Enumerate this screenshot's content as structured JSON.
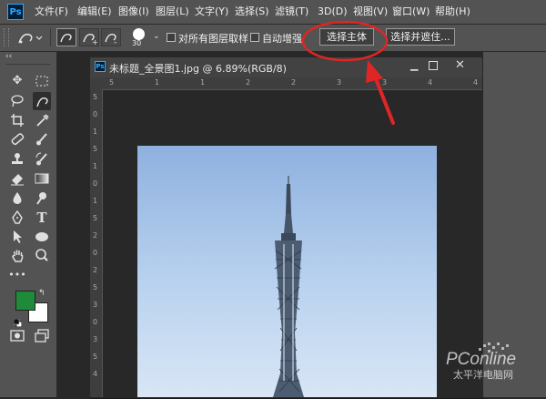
{
  "app": {
    "logo": "Ps"
  },
  "menubar": {
    "items": [
      {
        "id": "file",
        "label": "文件(F)"
      },
      {
        "id": "edit",
        "label": "编辑(E)"
      },
      {
        "id": "image",
        "label": "图像(I)"
      },
      {
        "id": "layer",
        "label": "图层(L)"
      },
      {
        "id": "type",
        "label": "文字(Y)"
      },
      {
        "id": "select",
        "label": "选择(S)"
      },
      {
        "id": "filter",
        "label": "滤镜(T)"
      },
      {
        "id": "3d",
        "label": "3D(D)"
      },
      {
        "id": "view",
        "label": "视图(V)"
      },
      {
        "id": "window",
        "label": "窗口(W)"
      },
      {
        "id": "help",
        "label": "帮助(H)"
      }
    ]
  },
  "options_bar": {
    "brush_size": "30",
    "sample_all_layers": {
      "label": "对所有图层取样",
      "checked": false
    },
    "auto_enhance": {
      "label": "自动增强",
      "checked": false
    },
    "select_subject": "选择主体",
    "select_and_mask": "选择并遮住..."
  },
  "document": {
    "title": "未标题_全景图1.jpg @ 6.89%(RGB/8)",
    "ruler_h": [
      "5",
      "1",
      "1",
      "2",
      "2",
      "3",
      "3",
      "4",
      "4"
    ],
    "ruler_v": [
      "5",
      "0",
      "1",
      "5",
      "1",
      "0",
      "1",
      "5",
      "2",
      "0",
      "2",
      "5",
      "3",
      "0",
      "3",
      "5",
      "4"
    ]
  },
  "swatches": {
    "foreground": "#1f8a3a",
    "background": "#ffffff"
  },
  "watermark": {
    "brand": "PConline",
    "subtitle": "太平洋电脑网"
  },
  "colors": {
    "annotation": "#e02525",
    "panel": "#535353",
    "canvas": "#282828"
  }
}
